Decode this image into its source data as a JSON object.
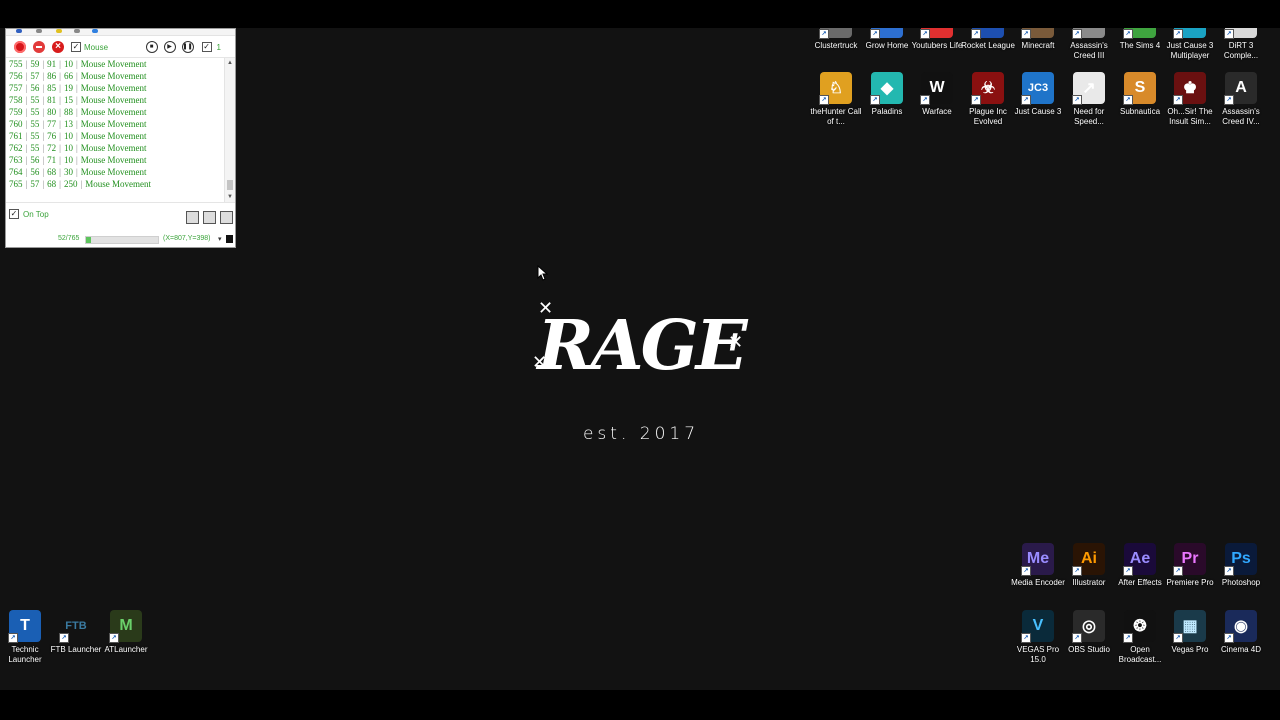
{
  "recorder": {
    "mouse_label": "Mouse",
    "repeat_count": "1",
    "rows": [
      {
        "id": "755",
        "x": "59",
        "y": "91",
        "delay": "10",
        "action": "Mouse Movement"
      },
      {
        "id": "756",
        "x": "57",
        "y": "86",
        "delay": "66",
        "action": "Mouse Movement"
      },
      {
        "id": "757",
        "x": "56",
        "y": "85",
        "delay": "19",
        "action": "Mouse Movement"
      },
      {
        "id": "758",
        "x": "55",
        "y": "81",
        "delay": "15",
        "action": "Mouse Movement"
      },
      {
        "id": "759",
        "x": "55",
        "y": "80",
        "delay": "88",
        "action": "Mouse Movement"
      },
      {
        "id": "760",
        "x": "55",
        "y": "77",
        "delay": "13",
        "action": "Mouse Movement"
      },
      {
        "id": "761",
        "x": "55",
        "y": "76",
        "delay": "10",
        "action": "Mouse Movement"
      },
      {
        "id": "762",
        "x": "55",
        "y": "72",
        "delay": "10",
        "action": "Mouse Movement"
      },
      {
        "id": "763",
        "x": "56",
        "y": "71",
        "delay": "10",
        "action": "Mouse Movement"
      },
      {
        "id": "764",
        "x": "56",
        "y": "68",
        "delay": "30",
        "action": "Mouse Movement"
      },
      {
        "id": "765",
        "x": "57",
        "y": "68",
        "delay": "250",
        "action": "Mouse Movement"
      }
    ],
    "on_top_label": "On Top",
    "progress_text": "52/765",
    "progress_fraction": 0.068,
    "coords_text": "(X=807,Y=398)"
  },
  "desktop_icons_top": [
    {
      "label": "Clustertruck",
      "icon": "clustertruck-icon",
      "color": "#6a6a6a"
    },
    {
      "label": "Grow Home",
      "icon": "grow-home-icon",
      "color": "#2d6fd1"
    },
    {
      "label": "Youtubers Life",
      "icon": "youtubers-life-icon",
      "color": "#e03030"
    },
    {
      "label": "Rocket League",
      "icon": "rocket-league-icon",
      "color": "#1d4fb0"
    },
    {
      "label": "Minecraft",
      "icon": "minecraft-icon",
      "color": "#7a5a3a"
    },
    {
      "label": "Assassin's Creed III",
      "icon": "assassins-creed-iii-icon",
      "color": "#8a8a8a"
    },
    {
      "label": "The Sims 4",
      "icon": "sims-4-icon",
      "color": "#3fa43f"
    },
    {
      "label": "Just Cause 3 Multiplayer",
      "icon": "just-cause-3-mp-icon",
      "color": "#1aa3c4"
    },
    {
      "label": "DiRT 3 Comple...",
      "icon": "dirt-3-icon",
      "color": "#d9d9d9"
    }
  ],
  "desktop_icons_second": [
    {
      "label": "theHunter Call of t...",
      "icon": "thehunter-icon",
      "color": "#e0a020",
      "text": "♘"
    },
    {
      "label": "Paladins",
      "icon": "paladins-icon",
      "color": "#23b8b0",
      "text": "◆"
    },
    {
      "label": "Warface",
      "icon": "warface-icon",
      "color": "#111111",
      "text": "W"
    },
    {
      "label": "Plague Inc Evolved",
      "icon": "plague-inc-icon",
      "color": "#8a1010",
      "text": "☣"
    },
    {
      "label": "Just Cause 3",
      "icon": "just-cause-3-icon",
      "color": "#1f74c9",
      "text": "JC3"
    },
    {
      "label": "Need for Speed...",
      "icon": "need-for-speed-icon",
      "color": "#e9e9e9",
      "text": "↗"
    },
    {
      "label": "Subnautica",
      "icon": "subnautica-icon",
      "color": "#d88a2a",
      "text": "S"
    },
    {
      "label": "Oh...Sir! The Insult Sim...",
      "icon": "oh-sir-icon",
      "color": "#6a1010",
      "text": "♚"
    },
    {
      "label": "Assassin's Creed IV...",
      "icon": "assassins-creed-iv-icon",
      "color": "#2a2a2a",
      "text": "A"
    }
  ],
  "desktop_icons_adobe": [
    {
      "label": "Media Encoder",
      "icon": "media-encoder-icon",
      "color": "#2a1a4a",
      "text": "Me",
      "fg": "#9a8cff"
    },
    {
      "label": "Illustrator",
      "icon": "illustrator-icon",
      "color": "#2a1404",
      "text": "Ai",
      "fg": "#ff9a00"
    },
    {
      "label": "After Effects",
      "icon": "after-effects-icon",
      "color": "#1a0a3a",
      "text": "Ae",
      "fg": "#9a8cff"
    },
    {
      "label": "Premiere Pro",
      "icon": "premiere-pro-icon",
      "color": "#2a0a2a",
      "text": "Pr",
      "fg": "#ea77ff"
    },
    {
      "label": "Photoshop",
      "icon": "photoshop-icon",
      "color": "#0a1a3a",
      "text": "Ps",
      "fg": "#31a8ff"
    }
  ],
  "desktop_icons_video": [
    {
      "label": "VEGAS Pro 15.0",
      "icon": "vegas-pro-15-icon",
      "color": "#0a2a3a",
      "text": "V",
      "fg": "#49c0ff"
    },
    {
      "label": "OBS Studio",
      "icon": "obs-studio-icon",
      "color": "#2a2a2a",
      "text": "◎",
      "fg": "#ffffff"
    },
    {
      "label": "Open Broadcast...",
      "icon": "open-broadcaster-icon",
      "color": "#111111",
      "text": "❂",
      "fg": "#ffffff"
    },
    {
      "label": "Vegas Pro",
      "icon": "vegas-pro-icon",
      "color": "#1a3a4a",
      "text": "▦",
      "fg": "#bfe9ff"
    },
    {
      "label": "Cinema 4D",
      "icon": "cinema-4d-icon",
      "color": "#1a2a5a",
      "text": "◉",
      "fg": "#ffffff"
    }
  ],
  "desktop_icons_left": [
    {
      "label": "Technic Launcher",
      "icon": "technic-launcher-icon",
      "color": "#1a5fb4",
      "text": "T",
      "fg": "#ffffff"
    },
    {
      "label": "FTB Launcher",
      "icon": "ftb-launcher-icon",
      "color": "#121212",
      "text": "FTB",
      "fg": "#3a7aa0"
    },
    {
      "label": "ATLauncher",
      "icon": "atlauncher-icon",
      "color": "#2a3a1a",
      "text": "M",
      "fg": "#6ad06a"
    }
  ],
  "logo": {
    "word": "RAGE",
    "tagline": "est. 2017"
  }
}
